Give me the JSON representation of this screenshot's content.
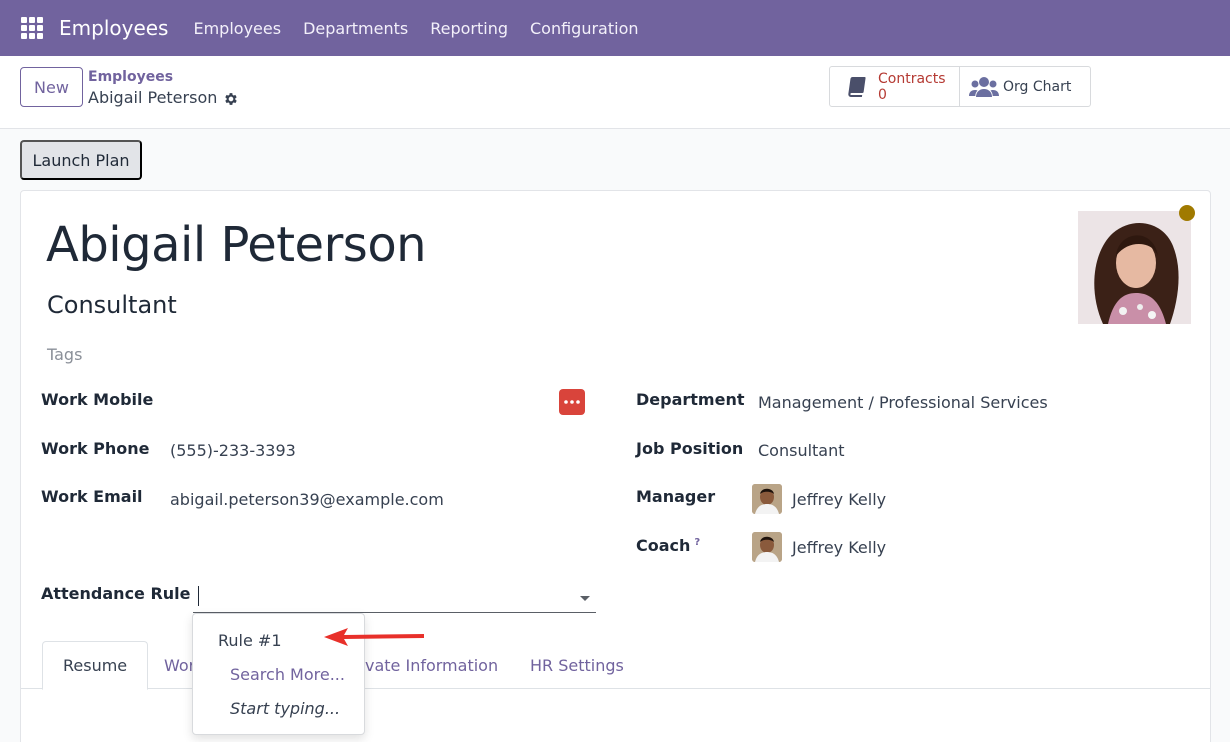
{
  "navbar": {
    "app_name": "Employees",
    "menu": [
      "Employees",
      "Departments",
      "Reporting",
      "Configuration"
    ]
  },
  "control_panel": {
    "new_label": "New",
    "breadcrumb_parent": "Employees",
    "breadcrumb_current": "Abigail Peterson",
    "smart_buttons": {
      "contracts_label": "Contracts",
      "contracts_count": "0",
      "org_chart_label": "Org Chart"
    }
  },
  "actions": {
    "launch_plan": "Launch Plan"
  },
  "employee": {
    "name": "Abigail Peterson",
    "job_title": "Consultant",
    "tags_placeholder": "Tags",
    "status_color": "#a07a00"
  },
  "fields": {
    "work_mobile_label": "Work Mobile",
    "work_phone_label": "Work Phone",
    "work_phone": "(555)-233-3393",
    "work_email_label": "Work Email",
    "work_email": "abigail.peterson39@example.com",
    "department_label": "Department",
    "department": "Management / Professional Services",
    "job_position_label": "Job Position",
    "job_position": "Consultant",
    "manager_label": "Manager",
    "manager": "Jeffrey Kelly",
    "coach_label": "Coach",
    "coach_help": "?",
    "coach": "Jeffrey Kelly",
    "attendance_rule_label": "Attendance Rule",
    "attendance_rule_value": ""
  },
  "tabs": {
    "resume": "Resume",
    "work_info_partial": "Wor",
    "private_partial": "vate Information",
    "hr_settings": "HR Settings"
  },
  "dropdown": {
    "items": [
      "Rule #1"
    ],
    "search_more": "Search More...",
    "start_typing": "Start typing..."
  },
  "colors": {
    "brand": "#71639e",
    "danger": "#b53a33",
    "annotation_arrow": "#e8302a"
  }
}
